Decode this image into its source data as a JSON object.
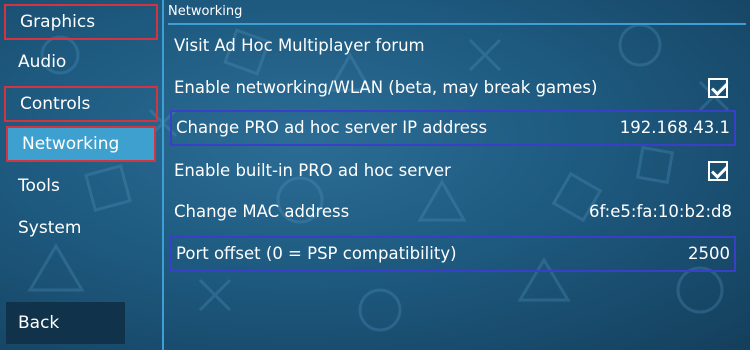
{
  "sidebar": {
    "items": [
      {
        "label": "Graphics"
      },
      {
        "label": "Audio"
      },
      {
        "label": "Controls"
      },
      {
        "label": "Networking"
      },
      {
        "label": "Tools"
      },
      {
        "label": "System"
      }
    ],
    "back_label": "Back"
  },
  "section": {
    "title": "Networking"
  },
  "settings": [
    {
      "label": "Visit Ad Hoc Multiplayer forum"
    },
    {
      "label": "Enable networking/WLAN (beta, may break games)",
      "checked": true
    },
    {
      "label": "Change PRO ad hoc server IP address",
      "value": "192.168.43.1"
    },
    {
      "label": "Enable built-in PRO ad hoc server",
      "checked": true
    },
    {
      "label": "Change MAC address",
      "value": "6f:e5:fa:10:b2:d8"
    },
    {
      "label": "Port offset (0 = PSP compatibility)",
      "value": "2500"
    }
  ],
  "colors": {
    "background": "#1d5677",
    "accent": "#3ea0cf",
    "highlight_red": "#d4343f",
    "highlight_blue": "#3a3fc9"
  }
}
